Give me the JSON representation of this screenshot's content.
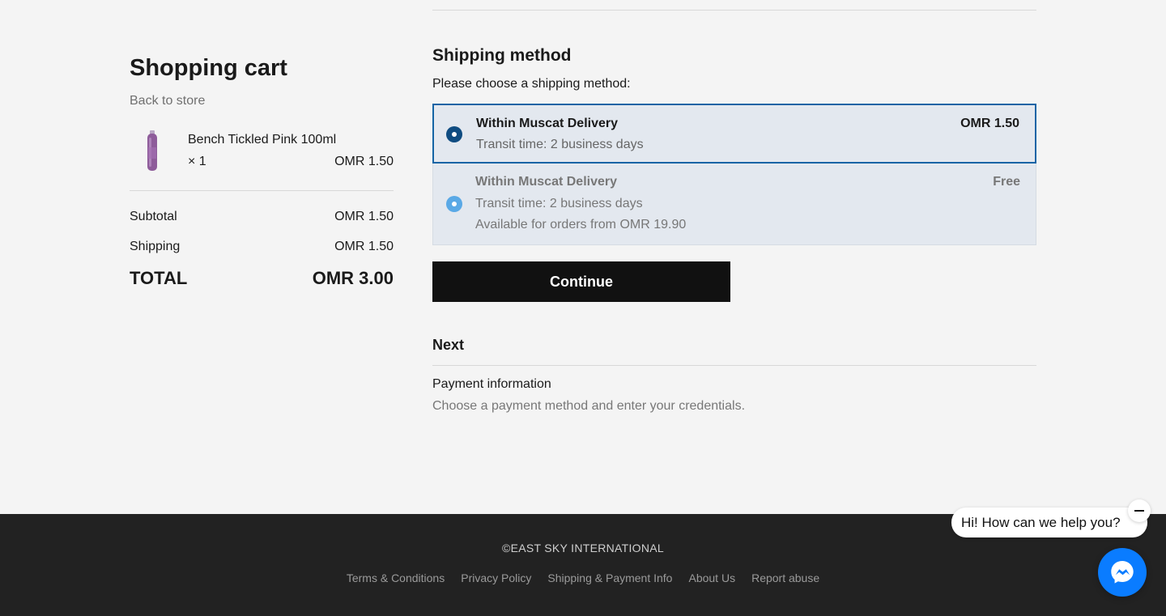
{
  "cart": {
    "title": "Shopping cart",
    "back_link": "Back to store",
    "item": {
      "name": "Bench Tickled Pink 100ml",
      "qty": "× 1",
      "price": "OMR 1.50"
    },
    "subtotal_label": "Subtotal",
    "subtotal_value": "OMR 1.50",
    "shipping_label": "Shipping",
    "shipping_value": "OMR 1.50",
    "total_label": "TOTAL",
    "total_value": "OMR 3.00"
  },
  "shipping": {
    "title": "Shipping method",
    "subtitle": "Please choose a shipping method:",
    "options": [
      {
        "name": "Within Muscat Delivery",
        "price": "OMR 1.50",
        "transit": "Transit time: 2 business days",
        "selected": true
      },
      {
        "name": "Within Muscat Delivery",
        "price": "Free",
        "transit": "Transit time: 2 business days",
        "note": "Available for orders from OMR 19.90",
        "selected": false
      }
    ],
    "continue_label": "Continue"
  },
  "next": {
    "title": "Next",
    "step_title": "Payment information",
    "step_desc": "Choose a payment method and enter your credentials."
  },
  "footer": {
    "copyright": "©EAST SKY INTERNATIONAL",
    "links": [
      "Terms & Conditions",
      "Privacy Policy",
      "Shipping & Payment Info",
      "About Us",
      "Report abuse"
    ]
  },
  "chat": {
    "greeting": "Hi! How can we help you?",
    "minimize_icon": "minus-icon",
    "launcher_icon": "messenger-icon"
  },
  "colors": {
    "selected_border": "#1464a5",
    "option_bg": "#e3e8ef",
    "button_bg": "#111111",
    "messenger_blue": "#0a7cff"
  }
}
